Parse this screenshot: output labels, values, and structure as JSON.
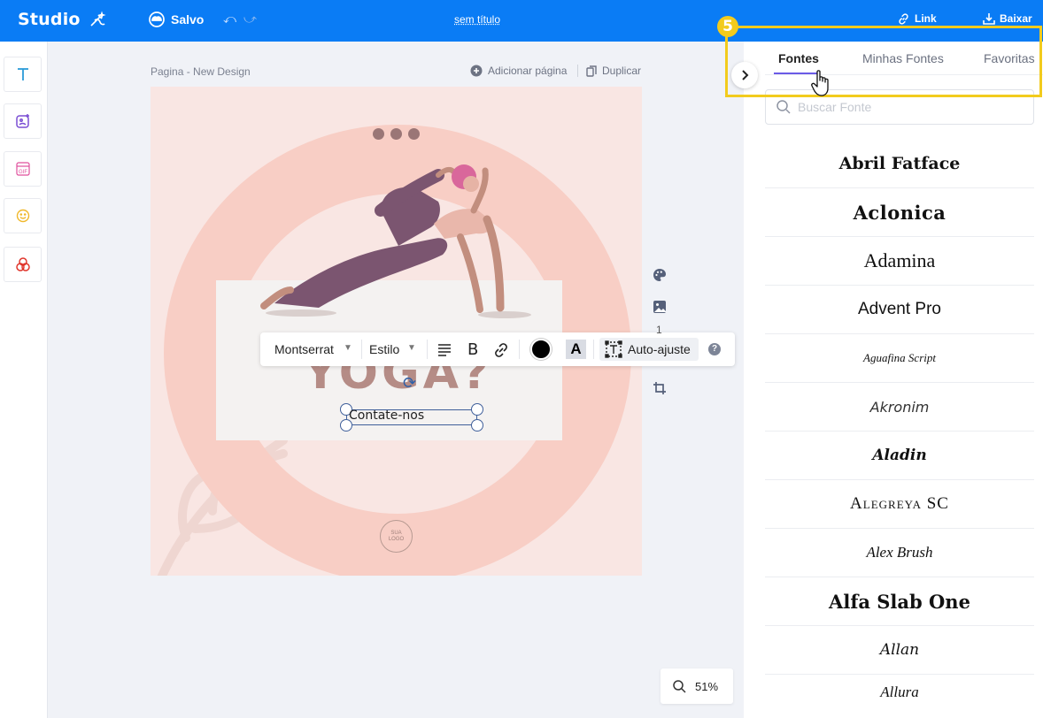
{
  "topbar": {
    "brand": "Studio",
    "saved_label": "Salvo",
    "undo_glyph": "⤺",
    "redo_glyph": "⤻",
    "doc_title": "sem título",
    "link_label": "Link",
    "download_label": "Baixar"
  },
  "left_tools": [
    {
      "name": "text-tool",
      "icon": "text-icon",
      "color": "#2a9bd8"
    },
    {
      "name": "image-tool",
      "icon": "image-sparkle-icon",
      "color": "#7b4fd4"
    },
    {
      "name": "gif-tool",
      "icon": "gif-icon",
      "color": "#e04f9c"
    },
    {
      "name": "emoji-tool",
      "icon": "smiley-icon",
      "color": "#f0b82b"
    },
    {
      "name": "shapes-tool",
      "icon": "shapes-icon",
      "color": "#e0352b"
    }
  ],
  "canvas_header": {
    "page_label": "Pagina - New Design",
    "add_page_label": "Adicionar página",
    "duplicate_label": "Duplicar"
  },
  "design": {
    "big_text": "YOGA?",
    "contact_text": "Contate-nos",
    "logo_text_line1": "SUA",
    "logo_text_line2": "LOGO"
  },
  "format_toolbar": {
    "font": "Montserrat",
    "style": "Estilo",
    "bold_glyph": "B",
    "bg_glyph": "A",
    "autofit_label": "Auto-ajuste",
    "help_glyph": "?",
    "text_color": "#000000"
  },
  "side_tools": {
    "page_number": "1"
  },
  "zoom": {
    "level": "51%"
  },
  "right_panel": {
    "collapse_glyph": "›",
    "tabs": [
      "Fontes",
      "Minhas Fontes",
      "Favoritas"
    ],
    "active_tab": "Fontes",
    "search_placeholder": "Buscar Fonte",
    "fonts": [
      "Abril Fatface",
      "Aclonica",
      "Adamina",
      "Advent Pro",
      "Aguafina Script",
      "Akronim",
      "Aladin",
      "Alegreya SC",
      "Alex Brush",
      "Alfa Slab One",
      "Allan",
      "Allura"
    ]
  },
  "annotation": {
    "step_number": "5",
    "highlight_color": "#f2cb1d"
  },
  "colors": {
    "topbar": "#0a7cf5",
    "accent_tab": "#6b5be6",
    "design_bg": "#f9e6e3",
    "ring": "#f8cec5"
  }
}
